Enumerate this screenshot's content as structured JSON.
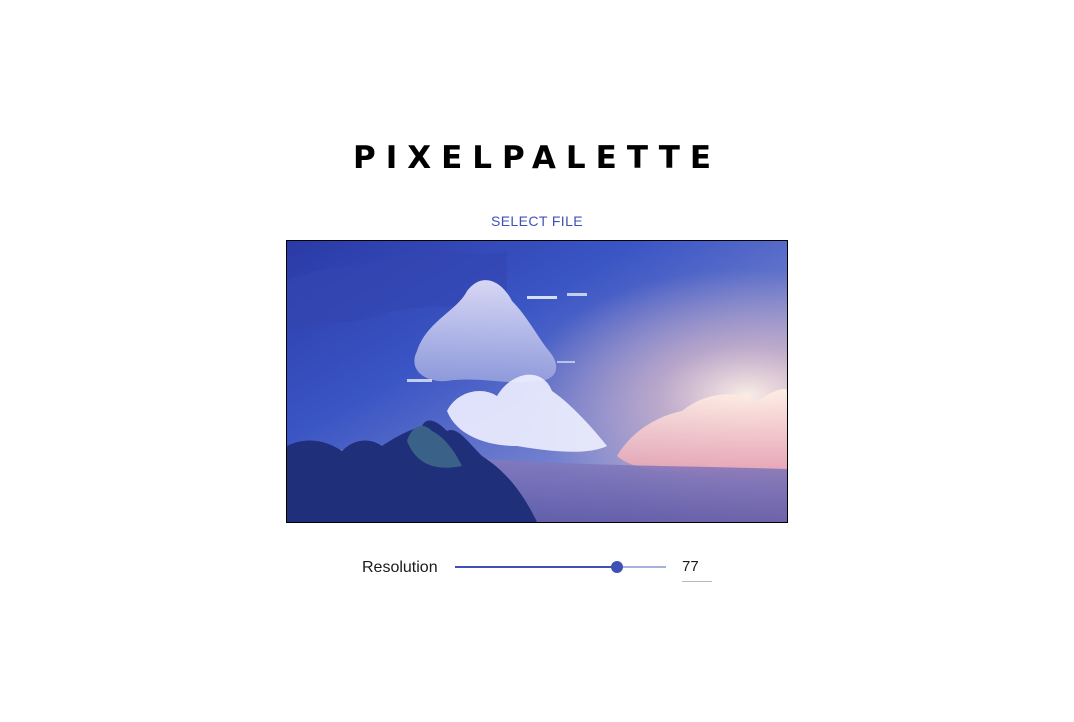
{
  "app": {
    "title": "PIXELPALETTE"
  },
  "upload": {
    "button_label": "SELECT FILE"
  },
  "preview": {
    "image_name": "anime-sky-clouds-landscape"
  },
  "resolution": {
    "label": "Resolution",
    "value": "77",
    "fraction": 0.77
  },
  "colors": {
    "accent": "#3f51b5",
    "text": "#000000"
  }
}
